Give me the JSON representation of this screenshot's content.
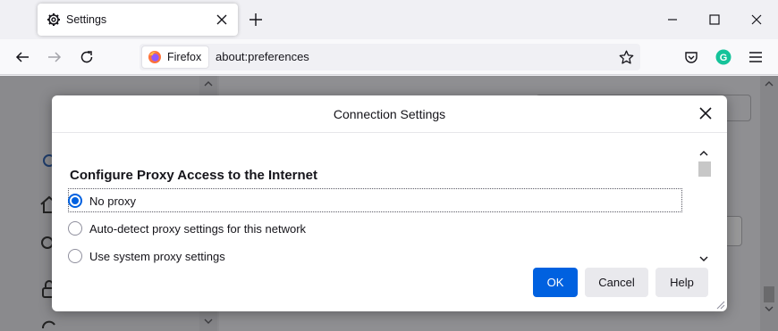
{
  "tab": {
    "title": "Settings",
    "icon": "gear-icon",
    "close_icon": "close-icon"
  },
  "toolbar": {
    "new_tab_icon": "plus-icon",
    "back_icon": "arrow-left-icon",
    "forward_icon": "arrow-right-icon",
    "reload_icon": "reload-icon",
    "pocket_icon": "pocket-icon",
    "grammarly_icon": "grammarly-icon",
    "grammarly_letter": "G",
    "menu_icon": "hamburger-menu-icon"
  },
  "window_controls": {
    "minimize": "minimize-icon",
    "maximize": "maximize-icon",
    "close": "close-icon"
  },
  "urlbar": {
    "identity_label": "Firefox",
    "url": "about:preferences",
    "bookmark_icon": "star-icon"
  },
  "dialog": {
    "title": "Connection Settings",
    "heading": "Configure Proxy Access to the Internet",
    "options": [
      {
        "label": "No proxy",
        "selected": true
      },
      {
        "label": "Auto-detect proxy settings for this network",
        "selected": false
      },
      {
        "label": "Use system proxy settings",
        "selected": false
      }
    ],
    "buttons": {
      "ok": "OK",
      "cancel": "Cancel",
      "help": "Help"
    }
  },
  "colors": {
    "accent": "#0061e0",
    "grammarly": "#15c39a",
    "firefox_orange": "#ff7139"
  }
}
